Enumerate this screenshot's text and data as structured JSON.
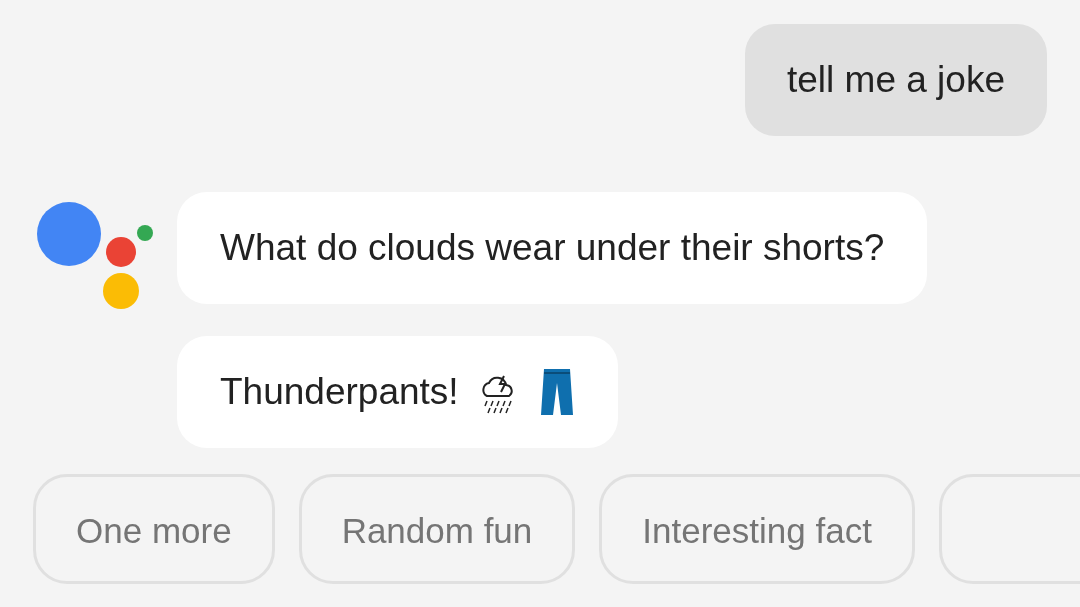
{
  "conversation": [
    {
      "kind": "user",
      "text": "tell me a joke"
    },
    {
      "kind": "assistant",
      "text": "What do clouds wear under their shorts?"
    },
    {
      "kind": "punchline",
      "text": "Thunderpants!"
    }
  ],
  "suggestions": [
    "One more",
    "Random fun",
    "Interesting fact"
  ]
}
